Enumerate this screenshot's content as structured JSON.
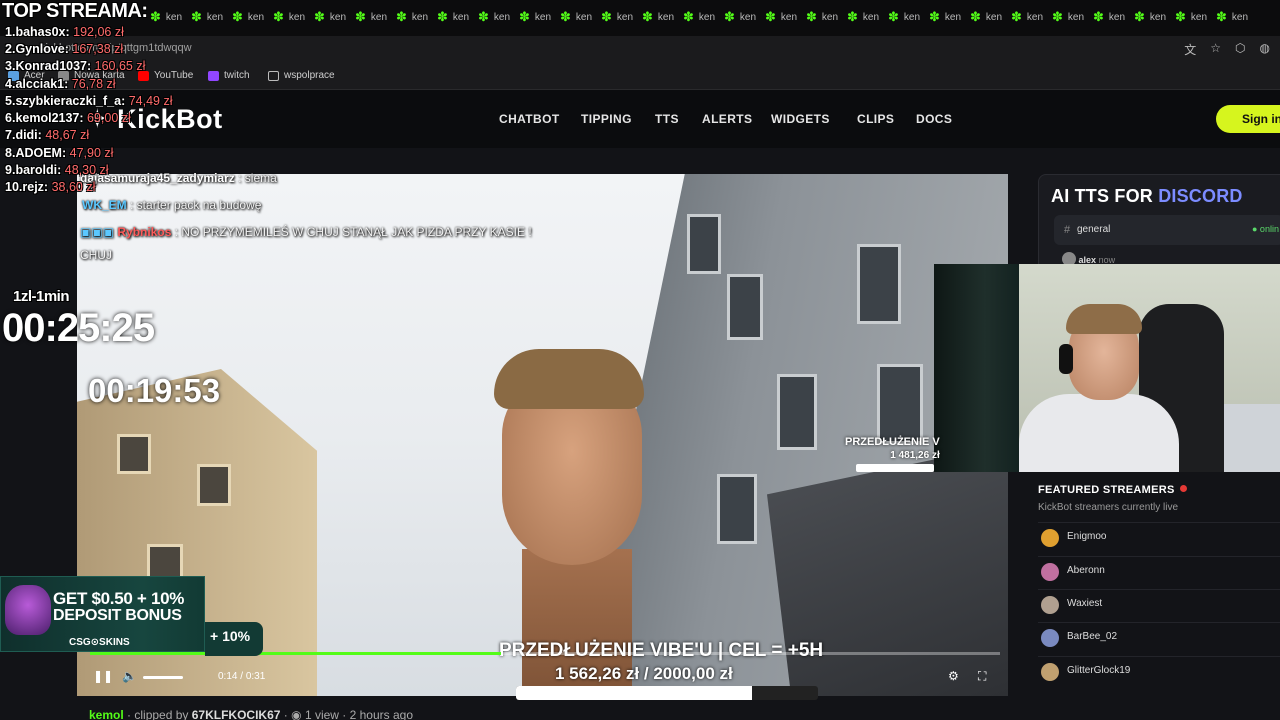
{
  "browser": {
    "tab_label": "ken",
    "tab_count": 27,
    "url": "kickbot.com/clip/qttgm1tdwqqw",
    "bookmarks": [
      {
        "label": "Acer",
        "color": "#5aa0e0"
      },
      {
        "label": "Nowa karta",
        "color": "#888888"
      },
      {
        "label": "YouTube",
        "color": "#ff0000"
      },
      {
        "label": "twitch",
        "color": "#9146ff"
      },
      {
        "label": "wspolprace",
        "color": "#888888"
      }
    ]
  },
  "site": {
    "logo": "KickBot",
    "nav": [
      "CHATBOT",
      "TIPPING",
      "TTS",
      "ALERTS",
      "WIDGETS",
      "CLIPS",
      "DOCS"
    ],
    "sign_in": "Sign in",
    "accent_color": "#53fc18"
  },
  "overlay": {
    "top_title": "TOP STREAMA:",
    "donors": [
      {
        "rank": "1.",
        "name": "bahas0x:",
        "amount": "192,06 zł"
      },
      {
        "rank": "2.",
        "name": "Gynlove:",
        "amount": "167,38 zł"
      },
      {
        "rank": "3.",
        "name": "Konrad1037:",
        "amount": "160,65 zł"
      },
      {
        "rank": "4.",
        "name": "alcciak1:",
        "amount": "76,78 zł"
      },
      {
        "rank": "5.",
        "name": "szybkieraczki_f_a:",
        "amount": "74,49 zł"
      },
      {
        "rank": "6.",
        "name": "kemol2137:",
        "amount": "69,00 zł"
      },
      {
        "rank": "7.",
        "name": "didi:",
        "amount": "48,67 zł"
      },
      {
        "rank": "8.",
        "name": "ADOEM:",
        "amount": "47,90 zł"
      },
      {
        "rank": "9.",
        "name": "baroldi:",
        "amount": "48,30 zł"
      },
      {
        "rank": "10.",
        "name": "rejz:",
        "amount": "38,60 zł"
      }
    ],
    "rate_label": "1zl-1min",
    "timer_main": "00:25:25",
    "timer_secondary": "00:19:53",
    "promo": {
      "line1": "GET $0.50 + 10%",
      "line2": "DEPOSIT BONUS",
      "brand": "CSG⊙SKINS",
      "partial": "+ 10%"
    }
  },
  "chat": [
    {
      "user": "dajasamuraja45_zadymiarz",
      "color": "#ffffff",
      "text": ": siema"
    },
    {
      "user": "WK_EM",
      "color": "#5bc8ff",
      "text": ": starter pack na budowę"
    },
    {
      "user": "Rybnikos",
      "color": "#ff5b5b",
      "text": ": NO PRZYMEMILEŚ W CHUJ STANĄŁ JAK PIZDA PRZY KASIE !"
    },
    {
      "user": "",
      "color": "#ffffff",
      "text": "CHUJ"
    }
  ],
  "goal": {
    "title": "PRZEDŁUŻENIE VIBE'U | CEL = +5H",
    "current": "1 562,26 zł",
    "separator": "/",
    "target": "2000,00 zł",
    "progress": 0.781
  },
  "webcam_goal": {
    "title": "PRZEDŁUŻENIE V",
    "amount": "1 481,26 zł"
  },
  "player": {
    "current_time": "0:14",
    "duration": "0:31",
    "progress": 0.452
  },
  "clip_info": {
    "streamer": "kemol",
    "clipped_by_prefix": "· clipped by",
    "clipper": "67KLFKOCIK67",
    "views": "1 view",
    "age": "2 hours ago"
  },
  "sidebar": {
    "ad_title_white": "AI TTS FOR",
    "ad_title_accent": "DISCORD",
    "channel": "general",
    "online": "● onlin",
    "message_user": "alex",
    "message_time": "now",
    "featured_title": "FEATURED STREAMERS",
    "featured_sub": "KickBot streamers currently live",
    "streamers": [
      {
        "name": "Enigmoo",
        "color": "#e0a030"
      },
      {
        "name": "Aberonn",
        "color": "#c070a0"
      },
      {
        "name": "Waxiest",
        "color": "#b0a090"
      },
      {
        "name": "BarBee_02",
        "color": "#7a8ac0"
      },
      {
        "name": "GlitterGlock19",
        "color": "#c0a070"
      }
    ]
  }
}
